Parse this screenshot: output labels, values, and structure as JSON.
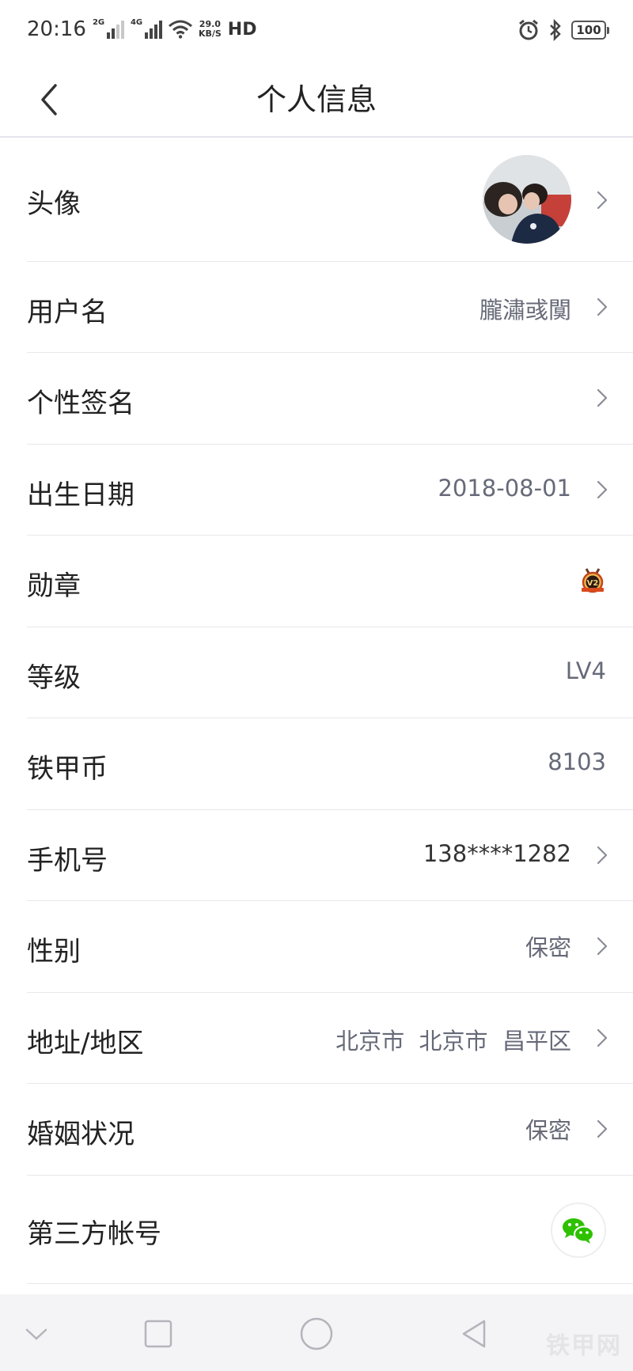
{
  "status_bar": {
    "time": "20:16",
    "network_1": "2G",
    "network_2": "4G",
    "speed_value": "29.0",
    "speed_unit": "KB/S",
    "hd": "HD",
    "battery": "100"
  },
  "header": {
    "title": "个人信息"
  },
  "rows": [
    {
      "label": "头像",
      "value": ""
    },
    {
      "label": "用户名",
      "value": "朧潚彧闃"
    },
    {
      "label": "个性签名",
      "value": ""
    },
    {
      "label": "出生日期",
      "value": "2018-08-01"
    },
    {
      "label": "勋章",
      "value": "",
      "medal_text": "V2"
    },
    {
      "label": "等级",
      "value": "LV4"
    },
    {
      "label": "铁甲币",
      "value": "8103"
    },
    {
      "label": "手机号",
      "value": "138****1282"
    },
    {
      "label": "性别",
      "value": "保密"
    },
    {
      "label": "地址/地区",
      "value": "北京市  北京市  昌平区"
    },
    {
      "label": "婚姻状况",
      "value": "保密"
    },
    {
      "label": "第三方帐号",
      "value": ""
    }
  ],
  "watermark": "铁甲网",
  "colors": {
    "accent_wechat": "#2dc100",
    "divider": "#e8e8ec",
    "value_text": "#666a78",
    "medal": "#d94a1e"
  }
}
